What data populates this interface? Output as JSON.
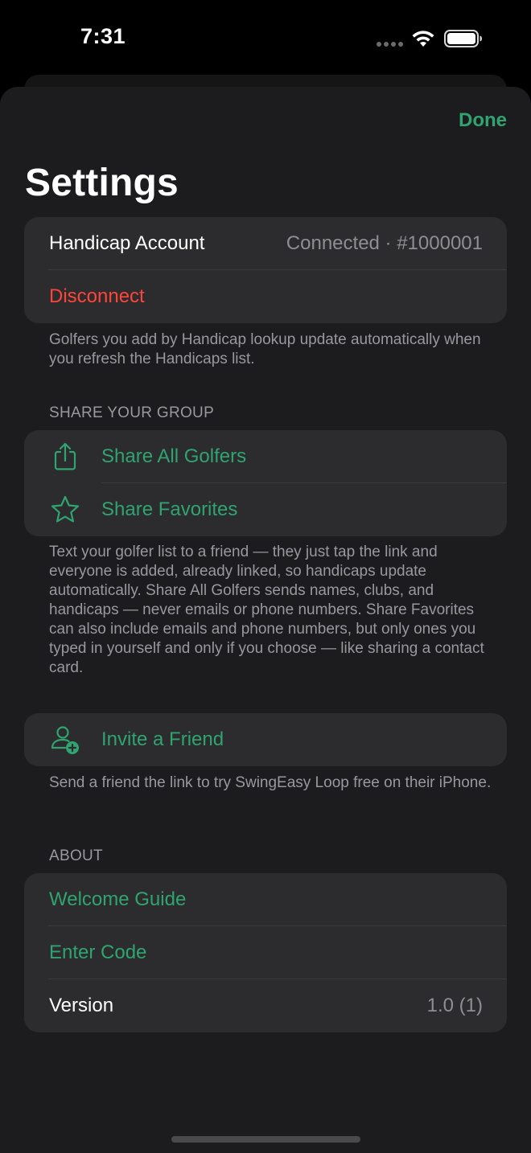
{
  "status_bar": {
    "time": "7:31"
  },
  "nav": {
    "done_label": "Done",
    "title": "Settings"
  },
  "handicap": {
    "account_label": "Handicap Account",
    "account_value": "Connected · #1000001",
    "disconnect_label": "Disconnect",
    "footer": "Golfers you add by Handicap lookup update automatically when you refresh the Handicaps list."
  },
  "share": {
    "header": "SHARE YOUR GROUP",
    "items": [
      {
        "label": "Share All Golfers",
        "icon": "share-icon"
      },
      {
        "label": "Share Favorites",
        "icon": "star-icon"
      }
    ],
    "footer": "Text your golfer list to a friend — they just tap the link and everyone is added, already linked, so handicaps update automatically. Share All Golfers sends names, clubs, and handicaps — never emails or phone numbers. Share Favorites can also include emails and phone numbers, but only ones you typed in yourself and only if you choose — like sharing a contact card."
  },
  "invite": {
    "label": "Invite a Friend",
    "icon": "person-add-icon",
    "footer": "Send a friend the link to try SwingEasy Loop free on their iPhone."
  },
  "about": {
    "header": "ABOUT",
    "welcome_label": "Welcome Guide",
    "enter_code_label": "Enter Code",
    "version_label": "Version",
    "version_value": "1.0 (1)"
  },
  "colors": {
    "accent": "#2fa470",
    "destructive": "#ff453a",
    "background": "#1c1c1e",
    "cell": "#2c2c2e",
    "secondary_text": "#98989e"
  }
}
